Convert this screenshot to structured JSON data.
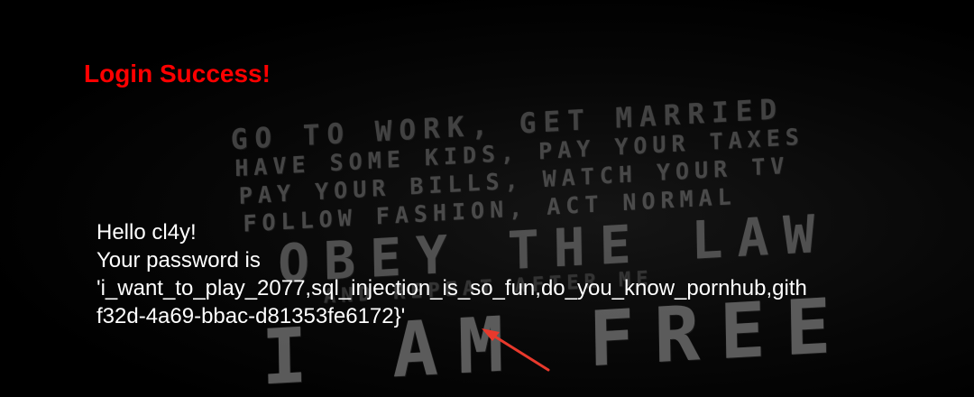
{
  "page": {
    "heading": "Login Success!",
    "greeting": "Hello cl4y!",
    "password_label": "Your password is",
    "password_line1": "'i_want_to_play_2077,sql_injection_is_so_fun,do_you_know_pornhub,gith",
    "password_line2": "f32d-4a69-bbac-d81353fe6172}'"
  },
  "background": {
    "lines": [
      "GO TO WORK, GET MARRIED",
      "HAVE SOME KIDS, PAY YOUR TAXES",
      "PAY YOUR BILLS, WATCH YOUR TV",
      "FOLLOW FASHION, ACT NORMAL",
      "OBEY THE LAW",
      "AND REPEAT AFTER ME",
      "I AM FREE"
    ]
  },
  "colors": {
    "heading": "#ff0000",
    "text": "#ffffff",
    "arrow": "#e8392c",
    "background": "#000000"
  }
}
